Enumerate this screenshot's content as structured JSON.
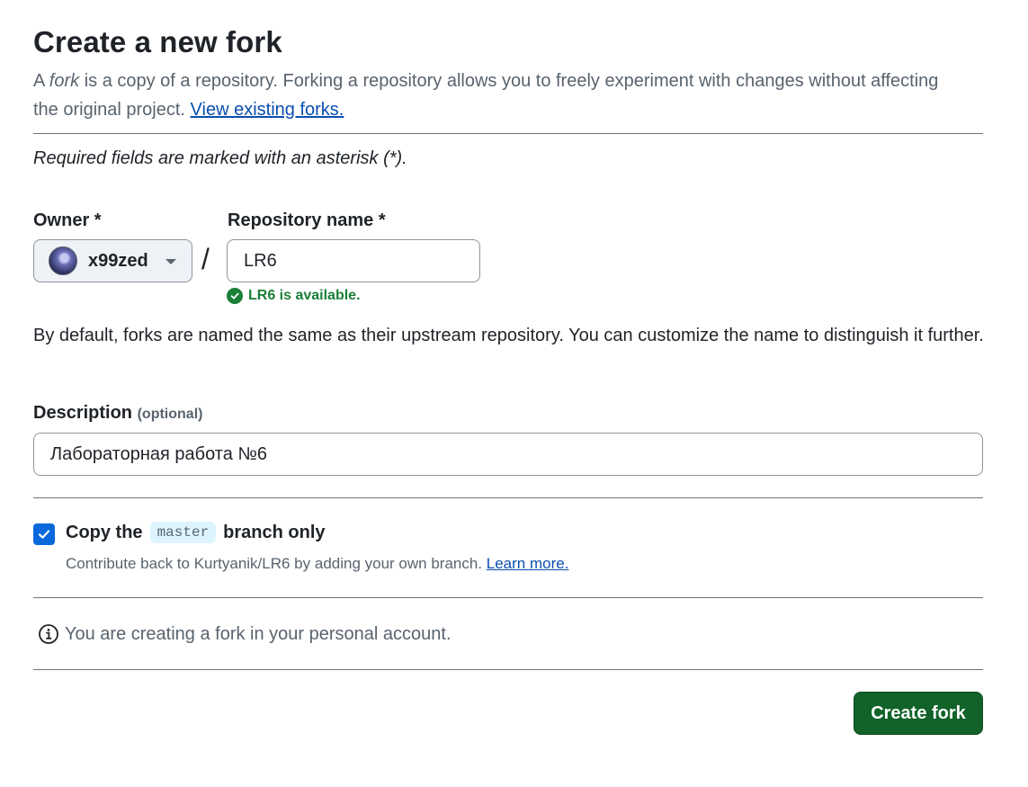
{
  "header": {
    "title": "Create a new fork",
    "intro_prefix": "A ",
    "intro_fork_word": "fork",
    "intro_rest": " is a copy of a repository. Forking a repository allows you to freely experiment with changes without affecting the original project. ",
    "view_forks_link": "View existing forks."
  },
  "form": {
    "required_note": "Required fields are marked with an asterisk (*).",
    "owner": {
      "label": "Owner *",
      "value": "x99zed"
    },
    "separator": "/",
    "repo_name": {
      "label": "Repository name *",
      "value": "LR6",
      "availability": "LR6 is available."
    },
    "default_note": "By default, forks are named the same as their upstream repository. You can customize the name to distinguish it further.",
    "description": {
      "label": "Description",
      "optional": "(optional)",
      "value": "Лабораторная работа №6"
    },
    "copy_branch": {
      "checked": true,
      "label_prefix": "Copy the",
      "branch": "master",
      "label_suffix": "branch only",
      "sub_text": "Contribute back to Kurtyanik/LR6 by adding your own branch. ",
      "learn_more": "Learn more."
    },
    "info": "You are creating a fork in your personal account.",
    "submit_label": "Create fork"
  },
  "colors": {
    "primary_button": "#116329",
    "link": "#0a4eb0",
    "success": "#1a7f37",
    "checkbox": "#0969da",
    "chip_bg": "#ddf4ff"
  }
}
